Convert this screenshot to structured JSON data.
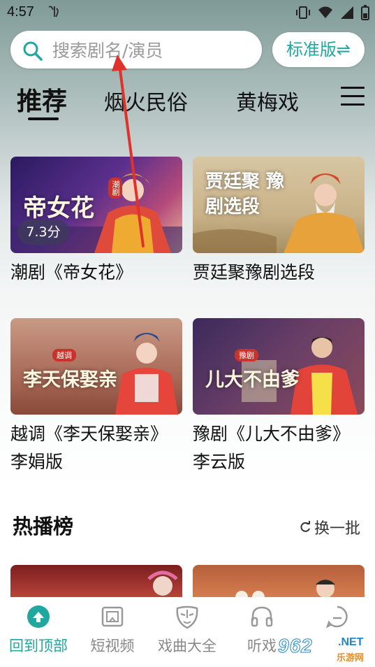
{
  "status_bar": {
    "time": "4:57"
  },
  "search": {
    "placeholder": "搜索剧名/演员"
  },
  "version_button": {
    "label": "标准版⇌"
  },
  "tabs": [
    {
      "label": "推荐",
      "active": true
    },
    {
      "label": "烟火民俗",
      "active": false
    },
    {
      "label": "黄梅戏",
      "active": false
    }
  ],
  "cards": [
    {
      "title": "潮剧《帝女花》",
      "poster_text": "帝女花",
      "tag": "潮剧",
      "rating": "7.3分"
    },
    {
      "title": "贾廷聚豫剧选段",
      "poster_text": "贾廷聚 豫剧选段",
      "tag": "",
      "rating": ""
    },
    {
      "title": "越调《李天保娶亲》李娟版",
      "poster_text": "李天保娶亲",
      "tag": "越调",
      "rating": ""
    },
    {
      "title": "豫剧《儿大不由爹》李云版",
      "poster_text": "儿大不由爹",
      "tag": "豫剧",
      "rating": ""
    }
  ],
  "section": {
    "title": "热播榜",
    "refresh_label": "换一批"
  },
  "bottom_nav": [
    {
      "label": "回到顶部",
      "icon": "back-to-top-icon",
      "active": true
    },
    {
      "label": "短视频",
      "icon": "short-video-icon",
      "active": false
    },
    {
      "label": "戏曲大全",
      "icon": "opera-mask-icon",
      "active": false
    },
    {
      "label": "听戏",
      "icon": "headphones-icon",
      "active": false
    },
    {
      "label": "",
      "icon": "profile-icon",
      "active": false
    }
  ],
  "watermark": {
    "number": "962",
    "suffix": ".NET",
    "subtitle": "乐游网"
  },
  "colors": {
    "accent": "#1fa7a0",
    "tag_red": "#c8332b",
    "annotation_arrow": "#e0322d"
  }
}
